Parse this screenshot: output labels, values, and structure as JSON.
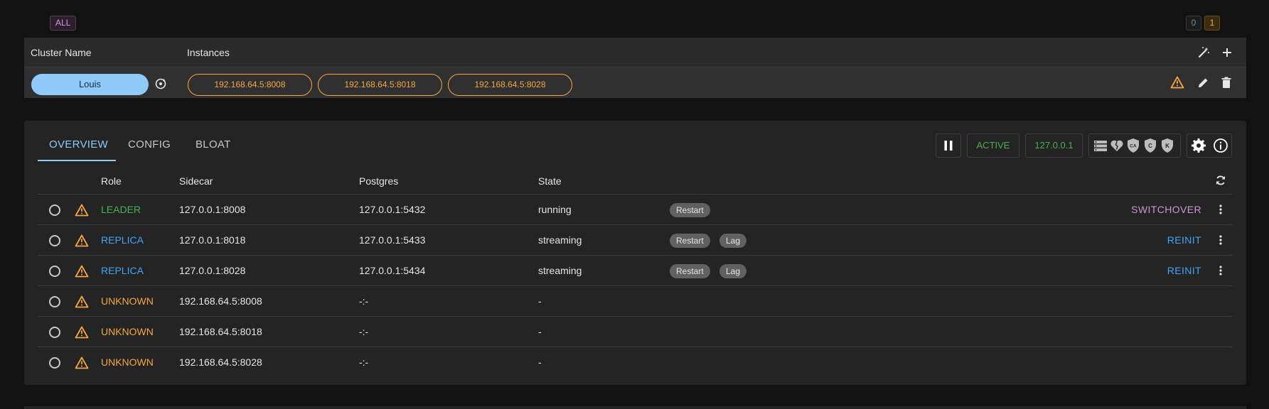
{
  "filter": {
    "all_label": "ALL",
    "count_zero": "0",
    "count_one": "1"
  },
  "cluster_table": {
    "headers": {
      "name": "Cluster Name",
      "instances": "Instances"
    },
    "row": {
      "name": "Louis",
      "instances": [
        "192.168.64.5:8008",
        "192.168.64.5:8018",
        "192.168.64.5:8028"
      ]
    }
  },
  "tabs": [
    {
      "label": "OVERVIEW",
      "active": true
    },
    {
      "label": "CONFIG",
      "active": false
    },
    {
      "label": "BLOAT",
      "active": false
    }
  ],
  "toolbar": {
    "status": "ACTIVE",
    "host": "127.0.0.1",
    "cert_badges": [
      "CA",
      "C",
      "K"
    ]
  },
  "members": {
    "headers": {
      "role": "Role",
      "sidecar": "Sidecar",
      "postgres": "Postgres",
      "state": "State"
    },
    "rows": [
      {
        "role": "LEADER",
        "sidecar": "127.0.0.1:8008",
        "postgres": "127.0.0.1:5432",
        "state": "running",
        "chips": [
          "Restart"
        ],
        "action": "SWITCHOVER"
      },
      {
        "role": "REPLICA",
        "sidecar": "127.0.0.1:8018",
        "postgres": "127.0.0.1:5433",
        "state": "streaming",
        "chips": [
          "Restart",
          "Lag"
        ],
        "action": "REINIT"
      },
      {
        "role": "REPLICA",
        "sidecar": "127.0.0.1:8028",
        "postgres": "127.0.0.1:5434",
        "state": "streaming",
        "chips": [
          "Restart",
          "Lag"
        ],
        "action": "REINIT"
      },
      {
        "role": "UNKNOWN",
        "sidecar": "192.168.64.5:8008",
        "postgres": "-:-",
        "state": "-",
        "chips": [],
        "action": ""
      },
      {
        "role": "UNKNOWN",
        "sidecar": "192.168.64.5:8018",
        "postgres": "-:-",
        "state": "-",
        "chips": [],
        "action": ""
      },
      {
        "role": "UNKNOWN",
        "sidecar": "192.168.64.5:8028",
        "postgres": "-:-",
        "state": "-",
        "chips": [],
        "action": ""
      }
    ]
  },
  "colors": {
    "leader": "#4caf50",
    "replica": "#42a5f5",
    "unknown": "#f5a742",
    "switchover": "#ce93d8",
    "accent": "#90caf9"
  }
}
